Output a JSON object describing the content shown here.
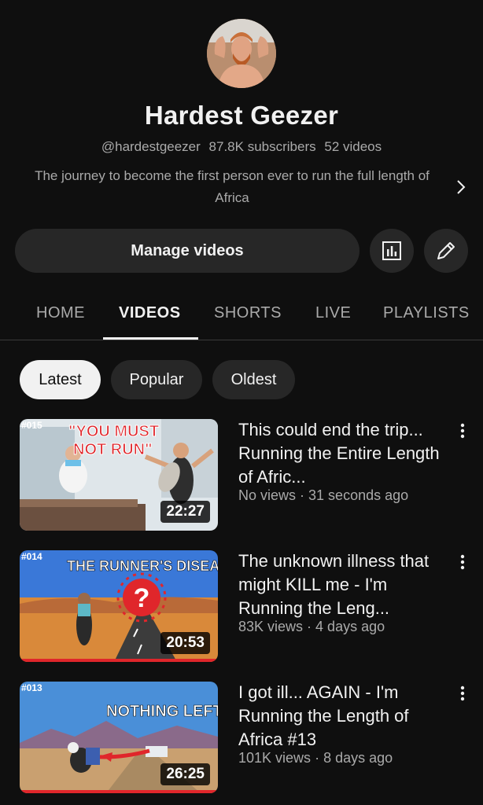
{
  "channel": {
    "name": "Hardest Geezer",
    "handle": "@hardestgeezer",
    "subscribers": "87.8K subscribers",
    "video_count": "52 videos",
    "description": "The journey to become the first person ever to run the full length of Africa"
  },
  "actions": {
    "manage_label": "Manage videos",
    "analytics_icon": "bar-chart-icon",
    "edit_icon": "pencil-icon"
  },
  "tabs": [
    {
      "label": "HOME",
      "active": false
    },
    {
      "label": "VIDEOS",
      "active": true
    },
    {
      "label": "SHORTS",
      "active": false
    },
    {
      "label": "LIVE",
      "active": false
    },
    {
      "label": "PLAYLISTS",
      "active": false
    }
  ],
  "filters": [
    {
      "label": "Latest",
      "active": true
    },
    {
      "label": "Popular",
      "active": false
    },
    {
      "label": "Oldest",
      "active": false
    }
  ],
  "videos": [
    {
      "title": "This could end the trip... Running the Entire Length of Afric...",
      "views": "No views",
      "age": "31 seconds ago",
      "duration": "22:27",
      "episode": "#015",
      "thumb_text_1": "\"YOU MUST",
      "thumb_text_2": "NOT RUN\""
    },
    {
      "title": "The unknown illness that might KILL me - I'm Running the Leng...",
      "views": "83K views",
      "age": "4 days ago",
      "duration": "20:53",
      "episode": "#014",
      "thumb_text_1": "THE RUNNER'S DISEASE",
      "thumb_text_2": "?"
    },
    {
      "title": "I got ill... AGAIN - I'm Running the Length of Africa #13",
      "views": "101K views",
      "age": "8 days ago",
      "duration": "26:25",
      "episode": "#013",
      "thumb_text_1": "NOTHING LEFT"
    }
  ],
  "colors": {
    "background": "#0f0f0f",
    "surface": "#272727",
    "text_primary": "#f1f1f1",
    "text_secondary": "#aaaaaa",
    "thumb_red": "#e0262b"
  }
}
